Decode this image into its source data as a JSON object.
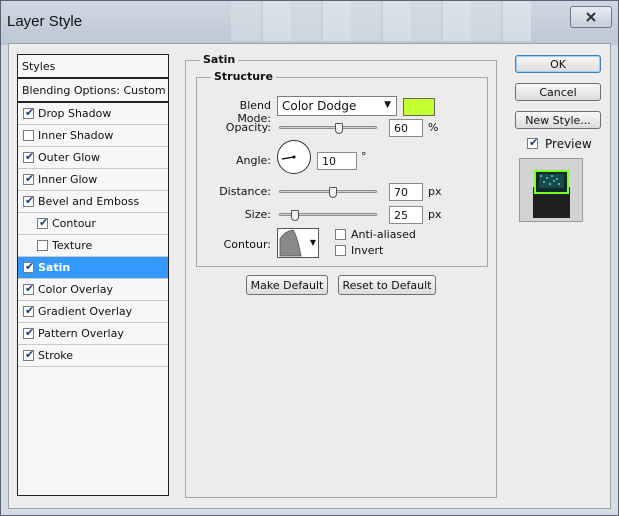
{
  "window": {
    "title": "Layer Style"
  },
  "style_list": {
    "header": "Styles",
    "blending_options": "Blending Options: Custom",
    "items": [
      {
        "label": "Drop Shadow",
        "checked": true,
        "sub": false
      },
      {
        "label": "Inner Shadow",
        "checked": false,
        "sub": false
      },
      {
        "label": "Outer Glow",
        "checked": true,
        "sub": false
      },
      {
        "label": "Inner Glow",
        "checked": true,
        "sub": false
      },
      {
        "label": "Bevel and Emboss",
        "checked": true,
        "sub": false
      },
      {
        "label": "Contour",
        "checked": true,
        "sub": true
      },
      {
        "label": "Texture",
        "checked": false,
        "sub": true
      },
      {
        "label": "Satin",
        "checked": true,
        "sub": false,
        "selected": true
      },
      {
        "label": "Color Overlay",
        "checked": true,
        "sub": false
      },
      {
        "label": "Gradient Overlay",
        "checked": true,
        "sub": false
      },
      {
        "label": "Pattern Overlay",
        "checked": true,
        "sub": false
      },
      {
        "label": "Stroke",
        "checked": true,
        "sub": false
      }
    ]
  },
  "satin": {
    "group_title": "Satin",
    "structure_title": "Structure",
    "blend_mode_label": "Blend Mode:",
    "blend_mode_value": "Color Dodge",
    "blend_color": "#c4ff2e",
    "opacity_label": "Opacity:",
    "opacity_value": "60",
    "opacity_unit": "%",
    "opacity_fraction": 0.6,
    "angle_label": "Angle:",
    "angle_value": "10",
    "angle_unit": "°",
    "distance_label": "Distance:",
    "distance_value": "70",
    "distance_unit": "px",
    "size_label": "Size:",
    "size_value": "25",
    "size_unit": "px",
    "contour_label": "Contour:",
    "anti_aliased_label": "Anti-aliased",
    "anti_aliased_checked": false,
    "invert_label": "Invert",
    "invert_checked": false,
    "make_default": "Make Default",
    "reset_default": "Reset to Default"
  },
  "buttons": {
    "ok": "OK",
    "cancel": "Cancel",
    "new_style": "New Style...",
    "preview_label": "Preview",
    "preview_checked": true
  },
  "icons": {
    "close": "close-icon",
    "dropdown": "chevron-down-icon",
    "check": "checkmark-icon"
  }
}
